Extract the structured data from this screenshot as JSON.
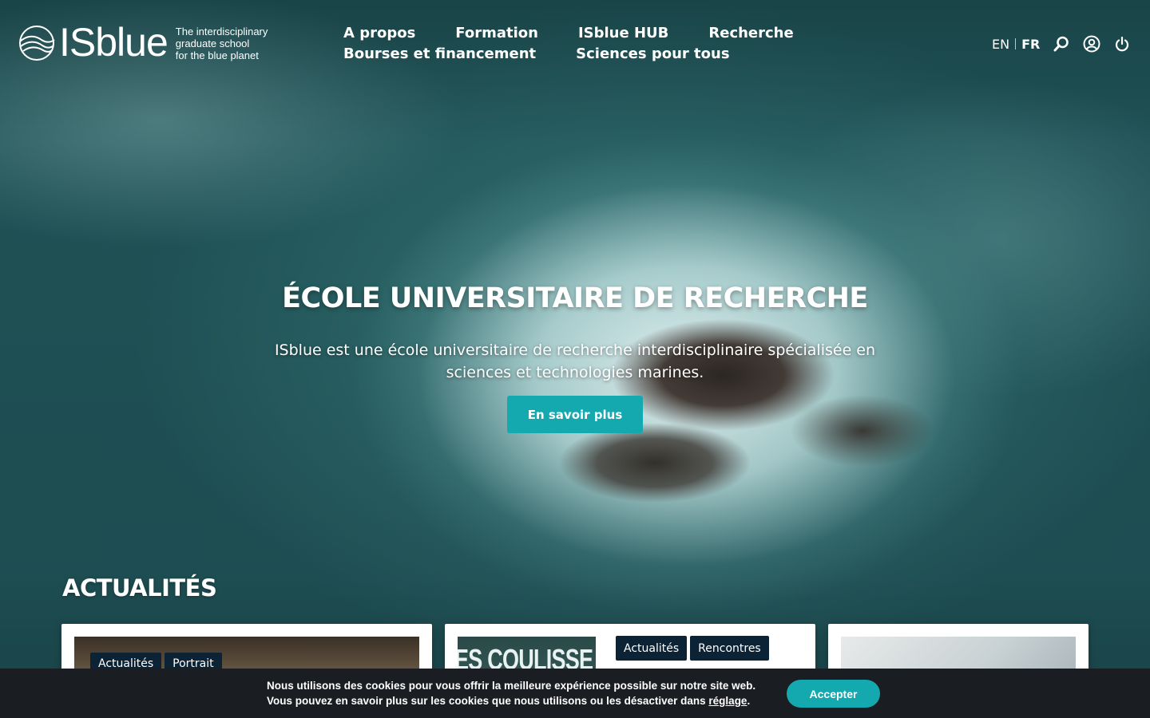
{
  "header": {
    "logo": {
      "wordmark": "ISblue",
      "tagline": [
        "The interdisciplinary",
        "graduate school",
        "for the blue planet"
      ]
    },
    "nav": [
      {
        "label": "A propos"
      },
      {
        "label": "Formation"
      },
      {
        "label": "ISblue HUB"
      },
      {
        "label": "Recherche"
      },
      {
        "label": "Bourses et financement"
      },
      {
        "label": "Sciences pour tous"
      }
    ],
    "languages": {
      "en": "EN",
      "fr": "FR",
      "active": "FR"
    },
    "icons": [
      "search-icon",
      "user-icon",
      "power-icon"
    ]
  },
  "hero": {
    "title": "ÉCOLE UNIVERSITAIRE DE RECHERCHE",
    "subtitle": "ISblue est une école universitaire de recherche interdisciplinaire spécialisée en sciences et technologies marines.",
    "cta": "En savoir plus"
  },
  "news": {
    "heading": "ACTUALITÉS",
    "cards": [
      {
        "tags": [
          "Actualités",
          "Portrait"
        ]
      },
      {
        "tags": [
          "Actualités",
          "Rencontres"
        ],
        "image_text": "ES COULISSE"
      },
      {
        "tags": []
      }
    ]
  },
  "cookie_banner": {
    "line1": "Nous utilisons des cookies pour vous offrir la meilleure expérience possible sur notre site web.",
    "line2_prefix": "Vous pouvez en savoir plus sur les cookies que nous utilisons ou les désactiver dans ",
    "link": "réglage",
    "line2_suffix": ".",
    "accept": "Accepter"
  },
  "colors": {
    "accent": "#14a9ae",
    "tag_bg": "#0c2235",
    "cookie_bg": "#1a1d21"
  }
}
